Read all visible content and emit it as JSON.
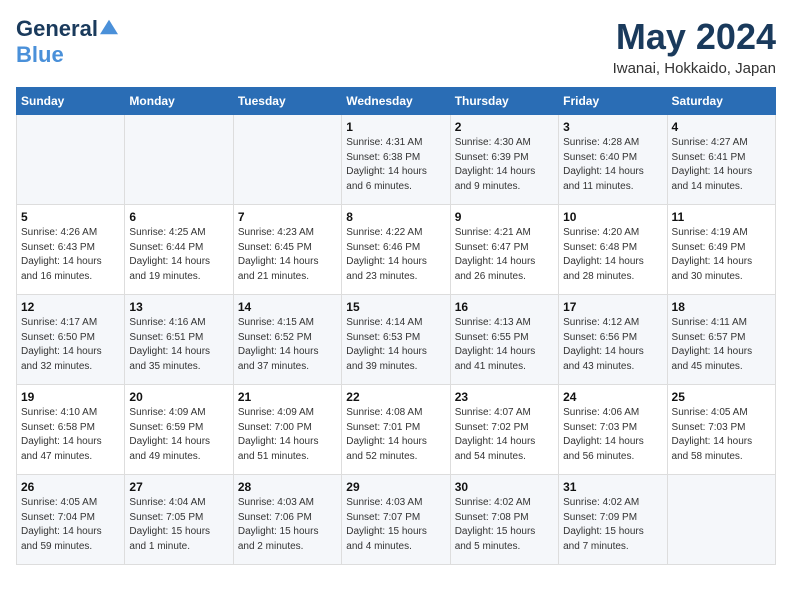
{
  "header": {
    "logo_general": "General",
    "logo_blue": "Blue",
    "month_title": "May 2024",
    "location": "Iwanai, Hokkaido, Japan"
  },
  "days_of_week": [
    "Sunday",
    "Monday",
    "Tuesday",
    "Wednesday",
    "Thursday",
    "Friday",
    "Saturday"
  ],
  "weeks": [
    [
      {
        "day": "",
        "info": ""
      },
      {
        "day": "",
        "info": ""
      },
      {
        "day": "",
        "info": ""
      },
      {
        "day": "1",
        "info": "Sunrise: 4:31 AM\nSunset: 6:38 PM\nDaylight: 14 hours\nand 6 minutes."
      },
      {
        "day": "2",
        "info": "Sunrise: 4:30 AM\nSunset: 6:39 PM\nDaylight: 14 hours\nand 9 minutes."
      },
      {
        "day": "3",
        "info": "Sunrise: 4:28 AM\nSunset: 6:40 PM\nDaylight: 14 hours\nand 11 minutes."
      },
      {
        "day": "4",
        "info": "Sunrise: 4:27 AM\nSunset: 6:41 PM\nDaylight: 14 hours\nand 14 minutes."
      }
    ],
    [
      {
        "day": "5",
        "info": "Sunrise: 4:26 AM\nSunset: 6:43 PM\nDaylight: 14 hours\nand 16 minutes."
      },
      {
        "day": "6",
        "info": "Sunrise: 4:25 AM\nSunset: 6:44 PM\nDaylight: 14 hours\nand 19 minutes."
      },
      {
        "day": "7",
        "info": "Sunrise: 4:23 AM\nSunset: 6:45 PM\nDaylight: 14 hours\nand 21 minutes."
      },
      {
        "day": "8",
        "info": "Sunrise: 4:22 AM\nSunset: 6:46 PM\nDaylight: 14 hours\nand 23 minutes."
      },
      {
        "day": "9",
        "info": "Sunrise: 4:21 AM\nSunset: 6:47 PM\nDaylight: 14 hours\nand 26 minutes."
      },
      {
        "day": "10",
        "info": "Sunrise: 4:20 AM\nSunset: 6:48 PM\nDaylight: 14 hours\nand 28 minutes."
      },
      {
        "day": "11",
        "info": "Sunrise: 4:19 AM\nSunset: 6:49 PM\nDaylight: 14 hours\nand 30 minutes."
      }
    ],
    [
      {
        "day": "12",
        "info": "Sunrise: 4:17 AM\nSunset: 6:50 PM\nDaylight: 14 hours\nand 32 minutes."
      },
      {
        "day": "13",
        "info": "Sunrise: 4:16 AM\nSunset: 6:51 PM\nDaylight: 14 hours\nand 35 minutes."
      },
      {
        "day": "14",
        "info": "Sunrise: 4:15 AM\nSunset: 6:52 PM\nDaylight: 14 hours\nand 37 minutes."
      },
      {
        "day": "15",
        "info": "Sunrise: 4:14 AM\nSunset: 6:53 PM\nDaylight: 14 hours\nand 39 minutes."
      },
      {
        "day": "16",
        "info": "Sunrise: 4:13 AM\nSunset: 6:55 PM\nDaylight: 14 hours\nand 41 minutes."
      },
      {
        "day": "17",
        "info": "Sunrise: 4:12 AM\nSunset: 6:56 PM\nDaylight: 14 hours\nand 43 minutes."
      },
      {
        "day": "18",
        "info": "Sunrise: 4:11 AM\nSunset: 6:57 PM\nDaylight: 14 hours\nand 45 minutes."
      }
    ],
    [
      {
        "day": "19",
        "info": "Sunrise: 4:10 AM\nSunset: 6:58 PM\nDaylight: 14 hours\nand 47 minutes."
      },
      {
        "day": "20",
        "info": "Sunrise: 4:09 AM\nSunset: 6:59 PM\nDaylight: 14 hours\nand 49 minutes."
      },
      {
        "day": "21",
        "info": "Sunrise: 4:09 AM\nSunset: 7:00 PM\nDaylight: 14 hours\nand 51 minutes."
      },
      {
        "day": "22",
        "info": "Sunrise: 4:08 AM\nSunset: 7:01 PM\nDaylight: 14 hours\nand 52 minutes."
      },
      {
        "day": "23",
        "info": "Sunrise: 4:07 AM\nSunset: 7:02 PM\nDaylight: 14 hours\nand 54 minutes."
      },
      {
        "day": "24",
        "info": "Sunrise: 4:06 AM\nSunset: 7:03 PM\nDaylight: 14 hours\nand 56 minutes."
      },
      {
        "day": "25",
        "info": "Sunrise: 4:05 AM\nSunset: 7:03 PM\nDaylight: 14 hours\nand 58 minutes."
      }
    ],
    [
      {
        "day": "26",
        "info": "Sunrise: 4:05 AM\nSunset: 7:04 PM\nDaylight: 14 hours\nand 59 minutes."
      },
      {
        "day": "27",
        "info": "Sunrise: 4:04 AM\nSunset: 7:05 PM\nDaylight: 15 hours\nand 1 minute."
      },
      {
        "day": "28",
        "info": "Sunrise: 4:03 AM\nSunset: 7:06 PM\nDaylight: 15 hours\nand 2 minutes."
      },
      {
        "day": "29",
        "info": "Sunrise: 4:03 AM\nSunset: 7:07 PM\nDaylight: 15 hours\nand 4 minutes."
      },
      {
        "day": "30",
        "info": "Sunrise: 4:02 AM\nSunset: 7:08 PM\nDaylight: 15 hours\nand 5 minutes."
      },
      {
        "day": "31",
        "info": "Sunrise: 4:02 AM\nSunset: 7:09 PM\nDaylight: 15 hours\nand 7 minutes."
      },
      {
        "day": "",
        "info": ""
      }
    ]
  ]
}
